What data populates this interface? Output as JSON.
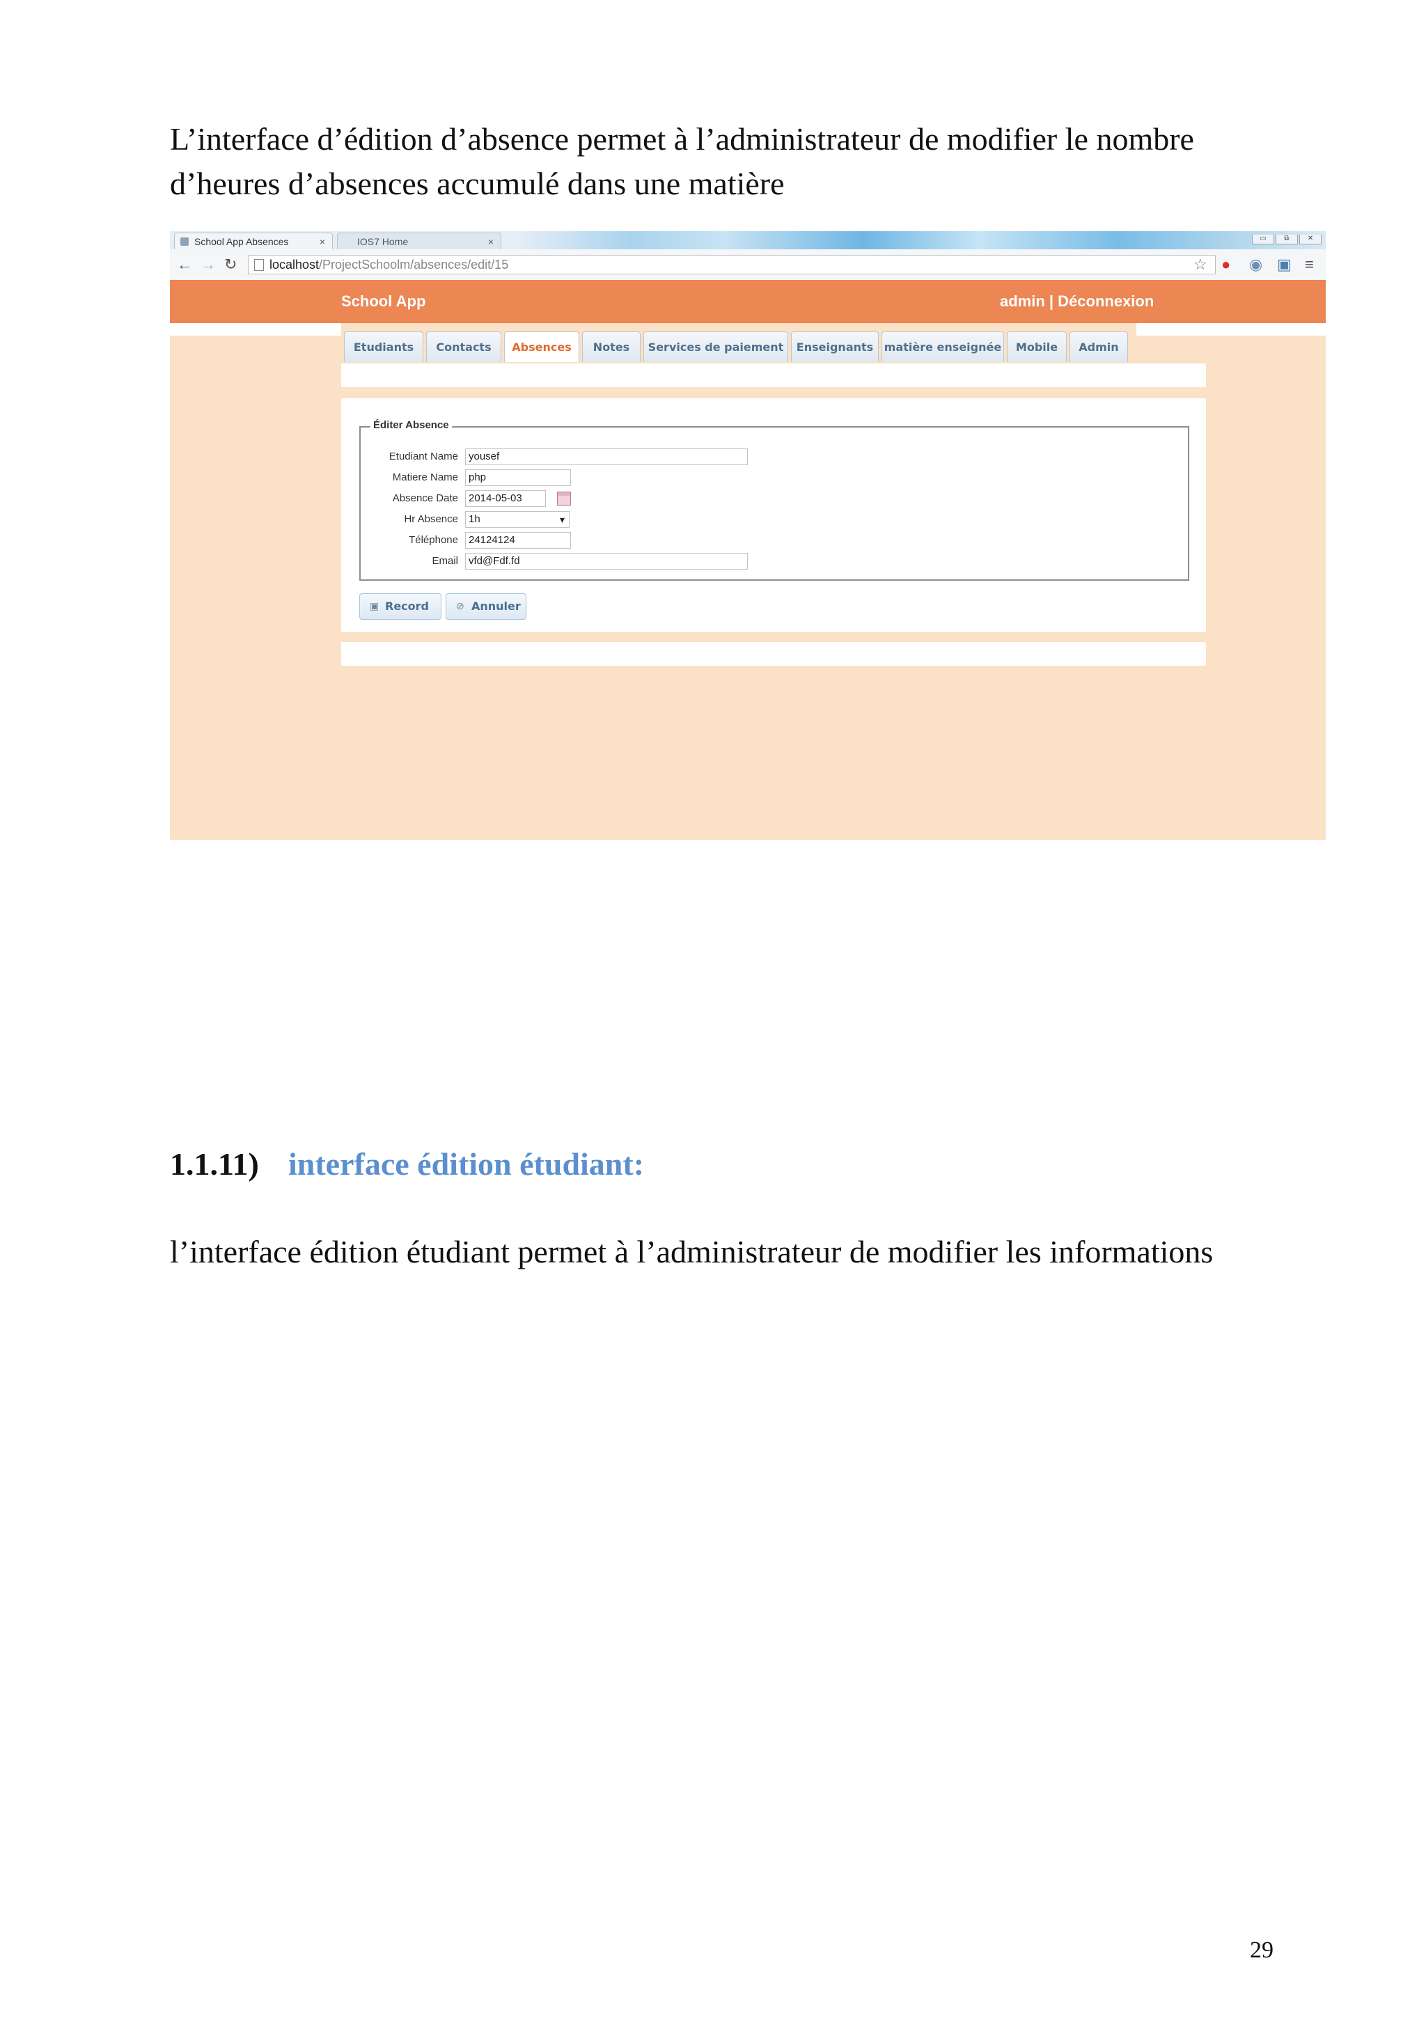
{
  "document": {
    "intro": "L’interface d’édition d’absence permet à l’administrateur de modifier le nombre d’heures d’absences accumulé dans une matière",
    "section_number": "1.1.11)",
    "section_title": "interface édition étudiant:",
    "outro": "l’interface édition étudiant permet à l’administrateur de modifier les informations",
    "page_number": "29"
  },
  "browser": {
    "tabs": [
      {
        "label": "School App Absences",
        "close": "×"
      },
      {
        "label": "IOS7 Home",
        "close": "×"
      }
    ],
    "url_host": "localhost",
    "url_path": "/ProjectSchoolm/absences/edit/15",
    "icons": [
      "back-arrow-icon",
      "forward-arrow-icon",
      "reload-icon",
      "star-icon",
      "opera-icon",
      "extension-icon",
      "screenshot-icon",
      "menu-icon"
    ]
  },
  "app": {
    "brand": "School App",
    "user_links": "admin | Déconnexion",
    "tabs": [
      {
        "label": "Etudiants"
      },
      {
        "label": "Contacts"
      },
      {
        "label": "Absences",
        "active": true
      },
      {
        "label": "Notes"
      },
      {
        "label": "Services de paiement"
      },
      {
        "label": "Enseignants"
      },
      {
        "label": "matière enseignée"
      },
      {
        "label": "Mobile"
      },
      {
        "label": "Admin"
      }
    ],
    "form": {
      "legend": "Éditer Absence",
      "fields": [
        {
          "label": "Etudiant Name",
          "value": "yousef"
        },
        {
          "label": "Matiere Name",
          "value": "php"
        },
        {
          "label": "Absence Date",
          "value": "2014-05-03"
        },
        {
          "label": "Hr Absence",
          "value": "1h"
        },
        {
          "label": "Téléphone",
          "value": "24124124"
        },
        {
          "label": "Email",
          "value": "vfd@Fdf.fd"
        }
      ],
      "record_button": "Record",
      "cancel_button": "Annuler"
    },
    "colors": {
      "header": "#ec8652",
      "background": "#fbe1c5",
      "tab_text": "#4d6f8d",
      "active_tab_text": "#e06a2e",
      "heading_blue": "#5b8fd0"
    }
  }
}
